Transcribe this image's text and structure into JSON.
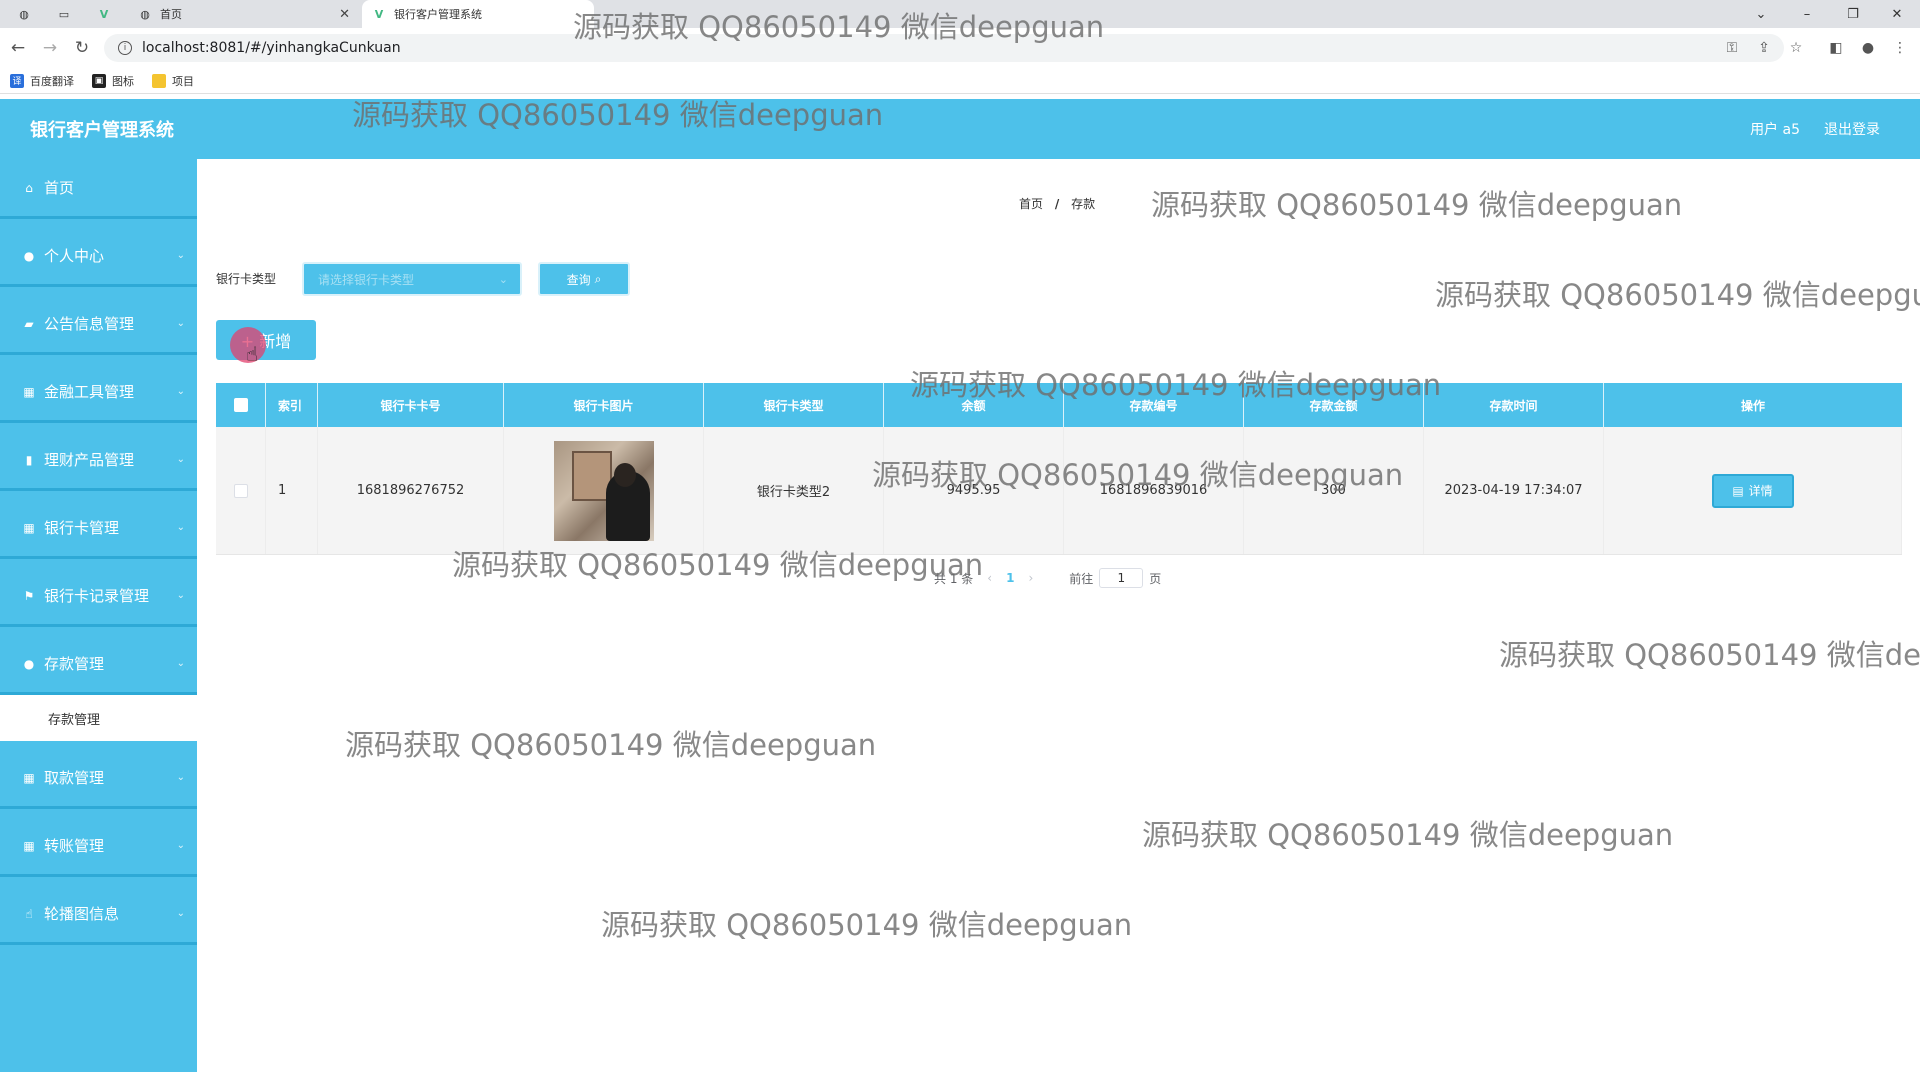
{
  "browser": {
    "tabs": [
      {
        "title": ""
      },
      {
        "title": ""
      },
      {
        "title": "首页"
      },
      {
        "title": "银行客户管理系统"
      }
    ],
    "url": "localhost:8081/#/yinhangkaCunkuan",
    "bookmarks": [
      {
        "label": "百度翻译",
        "icon": "translate-icon"
      },
      {
        "label": "图标",
        "icon": "bookmark-icon"
      },
      {
        "label": "项目",
        "icon": "folder-icon"
      }
    ]
  },
  "header": {
    "title": "银行客户管理系统",
    "user": "用户 a5",
    "logout": "退出登录"
  },
  "sidebar": {
    "items": [
      {
        "label": "首页",
        "icon": "home-icon"
      },
      {
        "label": "个人中心",
        "icon": "user-icon"
      },
      {
        "label": "公告信息管理",
        "icon": "chat-icon"
      },
      {
        "label": "金融工具管理",
        "icon": "grid-icon"
      },
      {
        "label": "理财产品管理",
        "icon": "chart-icon"
      },
      {
        "label": "银行卡管理",
        "icon": "grid-icon"
      },
      {
        "label": "银行卡记录管理",
        "icon": "flag-icon"
      },
      {
        "label": "存款管理",
        "icon": "user-icon"
      },
      {
        "label": "存款管理",
        "icon": ""
      },
      {
        "label": "取款管理",
        "icon": "grid-icon"
      },
      {
        "label": "转账管理",
        "icon": "grid-icon"
      },
      {
        "label": "轮播图信息",
        "icon": "thumb-icon"
      }
    ]
  },
  "breadcrumb": {
    "home": "首页",
    "current": "存款",
    "separator": "/"
  },
  "filter": {
    "label": "银行卡类型",
    "placeholder": "请选择银行卡类型",
    "query_button": "查询"
  },
  "add_button": "+ 新增",
  "table": {
    "columns": [
      "索引",
      "银行卡卡号",
      "银行卡图片",
      "银行卡类型",
      "余额",
      "存款编号",
      "存款金额",
      "存款时间",
      "操作"
    ],
    "rows": [
      {
        "index": "1",
        "card_no": "1681896276752",
        "card_type": "银行卡类型2",
        "balance": "9495.95",
        "deposit_no": "1681896839016",
        "amount": "300",
        "time": "2023-04-19 17:34:07",
        "action": "详情"
      }
    ]
  },
  "pagination": {
    "total": "共 1 条",
    "current": "1",
    "goto_label": "前往",
    "goto_value": "1",
    "page_suffix": "页"
  },
  "watermark": "源码获取 QQ86050149 微信deepguan"
}
